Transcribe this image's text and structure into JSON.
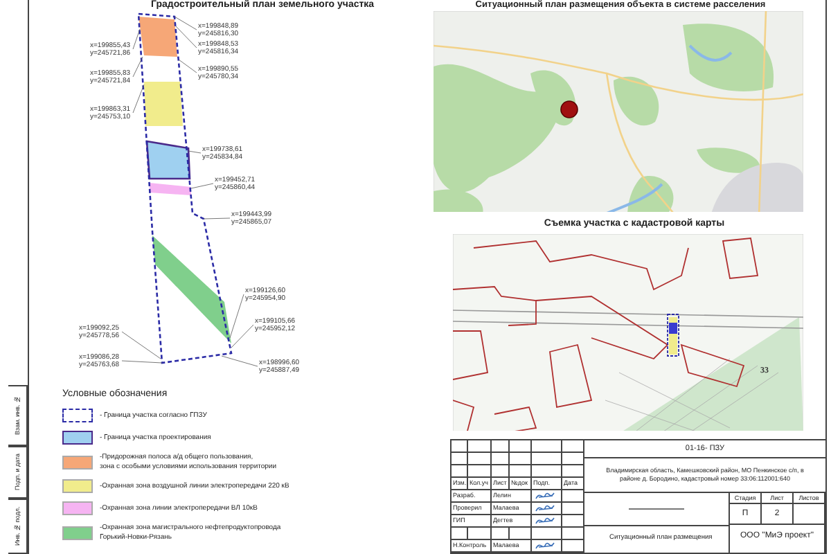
{
  "stamp": [
    "Взам. инв. №",
    "Подп. и дата",
    "Инв. № подл."
  ],
  "plan": {
    "title": "Градостроительный план земельного участка",
    "points": [
      {
        "x": "x=199848,89",
        "y": "y=245816,30"
      },
      {
        "x": "x=199848,53",
        "y": "y=245816,34"
      },
      {
        "x": "x=199890,55",
        "y": "y=245780,34"
      },
      {
        "x": "x=199738,61",
        "y": "y=245834,84"
      },
      {
        "x": "x=199452,71",
        "y": "y=245860,44"
      },
      {
        "x": "x=199443,99",
        "y": "y=245865,07"
      },
      {
        "x": "x=199126,60",
        "y": "y=245954,90"
      },
      {
        "x": "x=199105,66",
        "y": "y=245952,12"
      },
      {
        "x": "x=198996,60",
        "y": "y=245887,49"
      },
      {
        "x": "x=199855,43",
        "y": "y=245721,86"
      },
      {
        "x": "x=199855,83",
        "y": "y=245721,84"
      },
      {
        "x": "x=199863,31",
        "y": "y=245753,10"
      },
      {
        "x": "x=199092,25",
        "y": "y=245778,56"
      },
      {
        "x": "x=199086,28",
        "y": "y=245763,68"
      }
    ]
  },
  "legend": {
    "title": "Условные обозначения",
    "items": [
      {
        "kind": "dashed",
        "color": "#2b2ba6",
        "text": "- Граница участка согласно ГПЗУ"
      },
      {
        "kind": "outlined",
        "color": "#9fd0f0",
        "text": "- Граница участка проектирования"
      },
      {
        "kind": "fill",
        "color": "#f6a777",
        "text": "-Придорожная полоса а/д общего пользования,\nзона с особыми условиями использования территории"
      },
      {
        "kind": "fill",
        "color": "#f1ec8c",
        "text": "-Охранная зона воздушной линии электропередачи 220 кВ"
      },
      {
        "kind": "fill",
        "color": "#f6b4f2",
        "text": "-Охранная зона линии электропередачи ВЛ 10кВ"
      },
      {
        "kind": "fill",
        "color": "#80cf8c",
        "text": "-Охранная зона магистрального нефтепродуктопровода\nГорький-Новки-Рязань"
      }
    ]
  },
  "situation_map": {
    "title": "Ситуационный план размещения объекта в системе расселения"
  },
  "cadastral_map": {
    "title": "Съемка участка с кадастровой карты",
    "label": "33"
  },
  "title_block": {
    "code": "01-16- ПЗУ",
    "address": "Владимирская область, Камешковский район, МО Пенкинское с/п, в районе д. Бородино, кадастровый номер 33:06:112001:640",
    "columns": [
      "Изм.",
      "Кол.уч",
      "Лист",
      "№док",
      "Подп.",
      "Дата"
    ],
    "staff": [
      {
        "role": "Разраб.",
        "name": "Лелин",
        "signed": true
      },
      {
        "role": "Проверил",
        "name": "Малаева",
        "signed": true
      },
      {
        "role": "ГИП",
        "name": "Дегтев",
        "signed": true
      },
      {
        "role": "Н.Контроль",
        "name": "Малаева",
        "signed": true
      }
    ],
    "sheet_title": "Ситуационный план размещения",
    "stage_headers": [
      "Стадия",
      "Лист",
      "Листов"
    ],
    "stage_values": [
      "П",
      "2"
    ],
    "company": "ООО \"МиЭ проект\""
  }
}
